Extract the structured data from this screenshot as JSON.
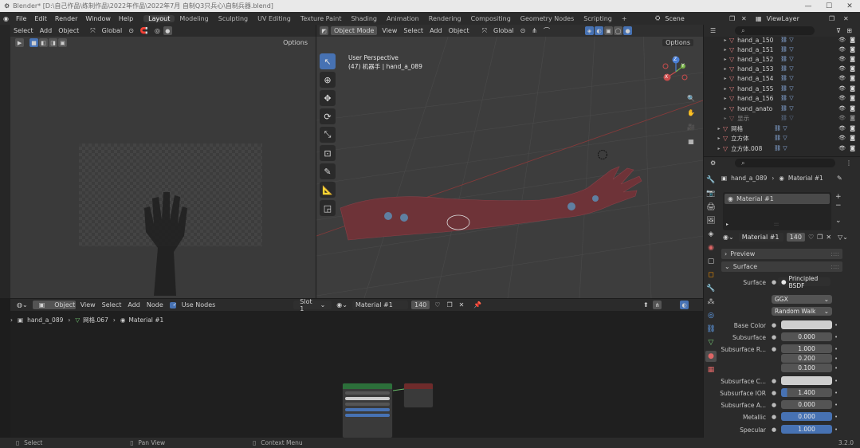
{
  "window": {
    "title": "Blender* [D:\\自己作品\\练制作品\\2022年作品\\2022年7月 自制Q3只兵心\\自制兵器.blend]",
    "minimize": "—",
    "maximize": "☐",
    "close": "✕"
  },
  "menu": {
    "items": [
      "File",
      "Edit",
      "Render",
      "Window",
      "Help"
    ]
  },
  "workspaces": {
    "tabs": [
      "Layout",
      "Modeling",
      "Sculpting",
      "UV Editing",
      "Texture Paint",
      "Shading",
      "Animation",
      "Rendering",
      "Compositing",
      "Geometry Nodes",
      "Scripting"
    ],
    "active": "Layout",
    "add": "+"
  },
  "scene": {
    "label": "Scene",
    "view_layer": "ViewLayer"
  },
  "left_view": {
    "header": [
      "Select",
      "Add",
      "Object"
    ],
    "transform": "Global",
    "options": "Options"
  },
  "viewport": {
    "mode": "Object Mode",
    "menus": [
      "View",
      "Select",
      "Add",
      "Object"
    ],
    "transform": "Global",
    "options": "Options",
    "info_line1": "User Perspective",
    "info_line2": "(47) 机器手 | hand_a_089",
    "gizmo_x": "X",
    "gizmo_y": "Y",
    "gizmo_z": "Z"
  },
  "outliner": {
    "search_placeholder": "",
    "rows": [
      "hand_a_150",
      "hand_a_151",
      "hand_a_152",
      "hand_a_153",
      "hand_a_154",
      "hand_a_155",
      "hand_a_156",
      "hand_anato",
      "显示",
      "网格",
      "立方体",
      "立方体.008"
    ]
  },
  "properties": {
    "search_placeholder": "",
    "object": "hand_a_089",
    "material": "Material #1",
    "slot_item": "Material #1",
    "mat_name": "Material #1",
    "users": "140",
    "preview": "Preview",
    "surface_panel": "Surface",
    "surface_label": "Surface",
    "surface_value": "Principled BSDF",
    "distribution": "GGX",
    "subsurface_method": "Random Walk",
    "fields": [
      {
        "label": "Base Color",
        "value": ""
      },
      {
        "label": "Subsurface",
        "value": "0.000"
      },
      {
        "label": "Subsurface R...",
        "value": "1.000"
      },
      {
        "label": "",
        "value": "0.200"
      },
      {
        "label": "",
        "value": "0.100"
      },
      {
        "label": "Subsurface C...",
        "value": ""
      },
      {
        "label": "Subsurface IOR",
        "value": "1.400"
      },
      {
        "label": "Subsurface A...",
        "value": "0.000"
      },
      {
        "label": "Metallic",
        "value": "0.000"
      },
      {
        "label": "Specular",
        "value": "1.000"
      }
    ],
    "colors": {
      "accent": "#4772b3",
      "base_color": "#cfcfcf"
    }
  },
  "node_editor": {
    "object_menu": "Object",
    "menus": [
      "View",
      "Select",
      "Add",
      "Node"
    ],
    "use_nodes": "Use Nodes",
    "slot": "Slot 1",
    "material": "Material #1",
    "users": "140",
    "breadcrumb": [
      "hand_a_089",
      "网格.067",
      "Material #1"
    ]
  },
  "statusbar": {
    "select": "Select",
    "pan": "Pan View",
    "context": "Context Menu",
    "version": "3.2.0"
  }
}
